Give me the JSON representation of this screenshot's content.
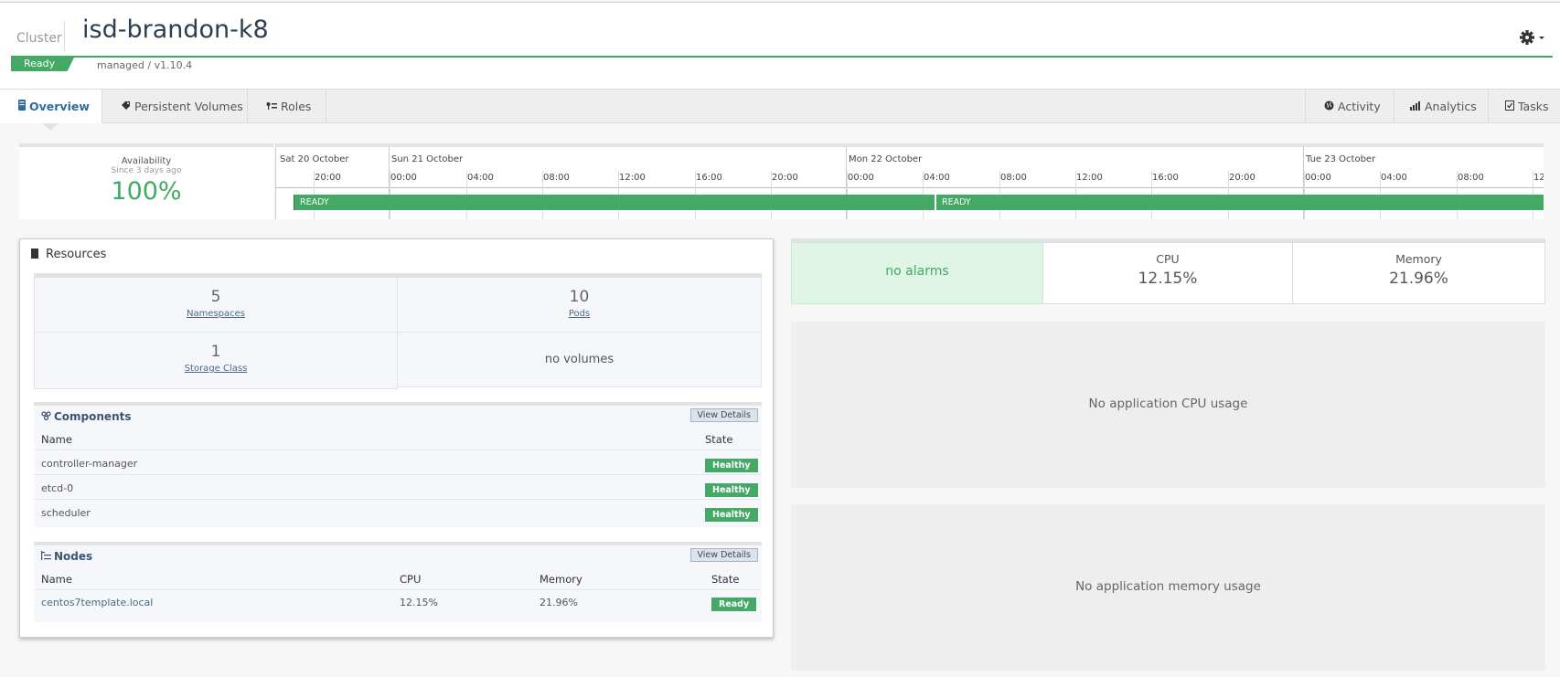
{
  "header": {
    "cluster_label": "Cluster",
    "title": "isd-brandon-k8",
    "status": "Ready",
    "managed": "managed / v1.10.4",
    "settings_icon": "gear-icon"
  },
  "tabs": {
    "left": [
      {
        "label": "Overview",
        "icon": "server-icon"
      },
      {
        "label": "Persistent Volumes",
        "icon": "tag-icon"
      },
      {
        "label": "Roles",
        "icon": "key-list-icon"
      }
    ],
    "right": [
      {
        "label": "Activity",
        "icon": "globe-icon"
      },
      {
        "label": "Analytics",
        "icon": "bar-chart-icon"
      },
      {
        "label": "Tasks",
        "icon": "checkbox-icon"
      }
    ]
  },
  "availability": {
    "label": "Availability",
    "since": "Since 3 days ago",
    "value": "100%"
  },
  "timeline": {
    "days": [
      "Sat 20 October",
      "Sun 21 October",
      "Mon 22 October",
      "Tue 23 October"
    ],
    "hours": [
      "20:00",
      "00:00",
      "04:00",
      "08:00",
      "12:00",
      "16:00",
      "20:00",
      "00:00",
      "04:00",
      "08:00",
      "12:00",
      "16:00",
      "20:00",
      "00:00",
      "04:00",
      "08:00",
      "12:"
    ],
    "segments": [
      {
        "label": "READY"
      },
      {
        "label": "READY"
      }
    ]
  },
  "resources": {
    "title": "Resources",
    "cells": [
      {
        "value": "5",
        "label": "Namespaces"
      },
      {
        "value": "10",
        "label": "Pods"
      },
      {
        "value": "1",
        "label": "Storage Class"
      },
      {
        "empty": "no volumes"
      }
    ],
    "components": {
      "title": "Components",
      "view_details": "View Details",
      "col_name": "Name",
      "col_state": "State",
      "rows": [
        {
          "name": "controller-manager",
          "state": "Healthy"
        },
        {
          "name": "etcd-0",
          "state": "Healthy"
        },
        {
          "name": "scheduler",
          "state": "Healthy"
        }
      ]
    },
    "nodes": {
      "title": "Nodes",
      "view_details": "View Details",
      "col_name": "Name",
      "col_cpu": "CPU",
      "col_memory": "Memory",
      "col_state": "State",
      "rows": [
        {
          "name": "centos7template.local",
          "cpu": "12.15%",
          "memory": "21.96%",
          "state": "Ready"
        }
      ]
    }
  },
  "summary": {
    "alarms": "no alarms",
    "cpu_label": "CPU",
    "cpu_value": "12.15%",
    "memory_label": "Memory",
    "memory_value": "21.96%"
  },
  "panels": {
    "cpu_empty": "No application CPU usage",
    "memory_empty": "No application memory usage"
  },
  "colors": {
    "accent_green": "#43a965",
    "title": "#2d3e50",
    "link": "#4a6a8a"
  }
}
